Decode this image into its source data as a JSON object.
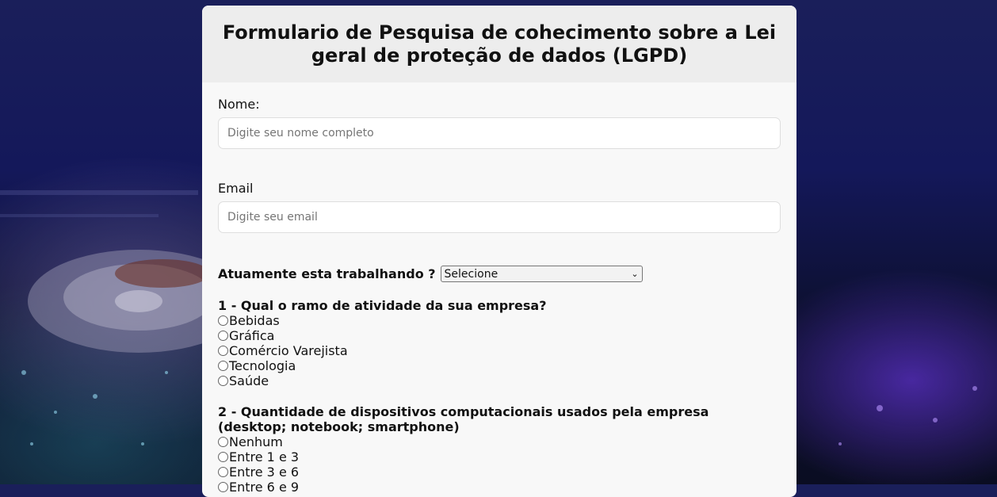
{
  "title": "Formulario de Pesquisa de cohecimento sobre a Lei geral de proteção de dados (LGPD)",
  "nome": {
    "label": "Nome:",
    "placeholder": "Digite seu nome completo"
  },
  "email": {
    "label": "Email",
    "placeholder": "Digite seu email"
  },
  "working": {
    "label": "Atuamente esta trabalhando ?",
    "selected": "Selecione"
  },
  "q1": {
    "title": "1 - Qual o ramo de atividade da sua empresa?",
    "options": [
      "Bebidas",
      "Gráfica",
      "Comércio Varejista",
      "Tecnologia",
      "Saúde"
    ]
  },
  "q2": {
    "title": "2 - Quantidade de dispositivos computacionais usados pela empresa (desktop; notebook; smartphone)",
    "options": [
      "Nenhum",
      "Entre 1 e 3",
      "Entre 3 e 6",
      "Entre 6 e 9"
    ]
  }
}
